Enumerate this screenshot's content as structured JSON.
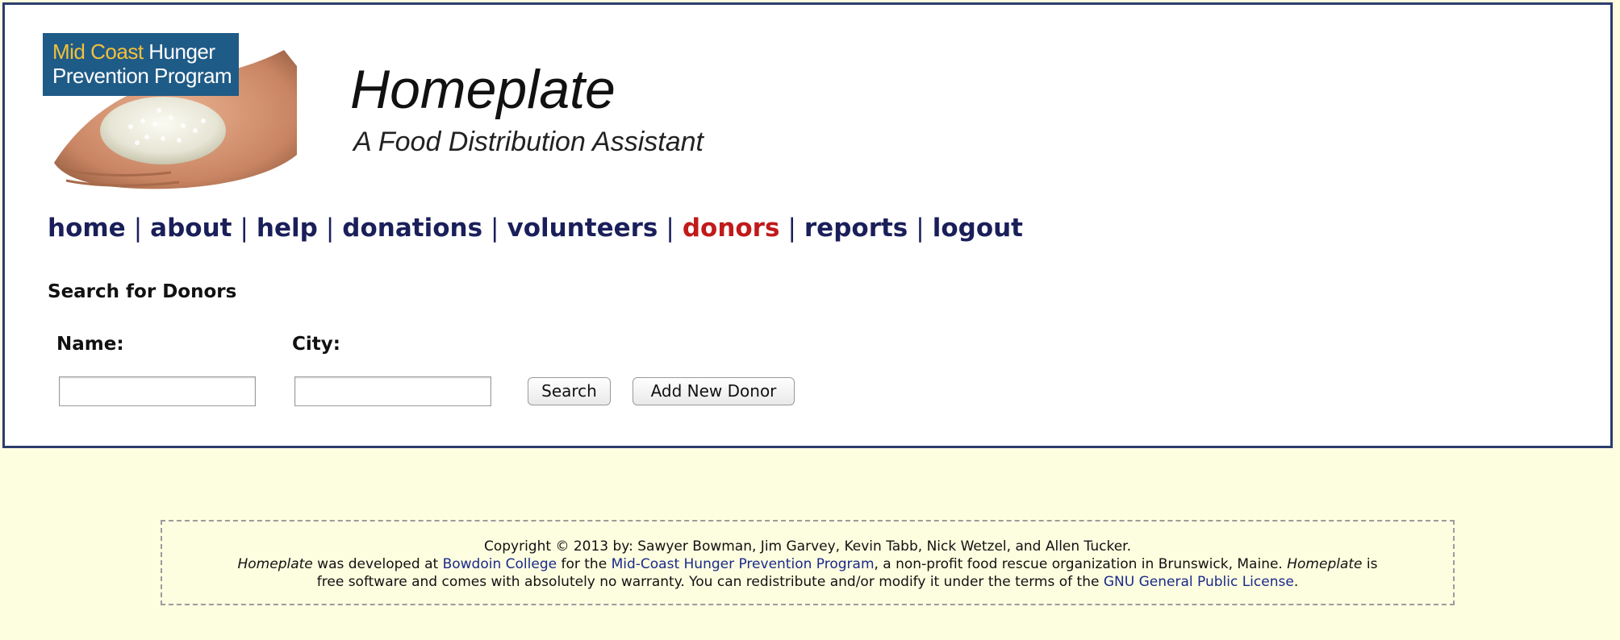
{
  "header": {
    "logo": {
      "line1_highlight": "Mid Coast",
      "line1_rest": " Hunger",
      "line2": "Prevention Program"
    },
    "title": "Homeplate",
    "subtitle": "A Food Distribution Assistant"
  },
  "nav": {
    "items": [
      {
        "label": "home",
        "active": false
      },
      {
        "label": "about",
        "active": false
      },
      {
        "label": "help",
        "active": false
      },
      {
        "label": "donations",
        "active": false
      },
      {
        "label": "volunteers",
        "active": false
      },
      {
        "label": "donors",
        "active": true
      },
      {
        "label": "reports",
        "active": false
      },
      {
        "label": "logout",
        "active": false
      }
    ],
    "separator": "|",
    "active_color": "#c11a1a",
    "link_color": "#1a1f5a"
  },
  "search": {
    "title": "Search for Donors",
    "name_label": "Name:",
    "city_label": "City:",
    "name_value": "",
    "city_value": "",
    "search_button": "Search",
    "add_button": "Add New Donor"
  },
  "footer": {
    "line1": "Copyright © 2013 by: Sawyer Bowman, Jim Garvey, Kevin Tabb, Nick Wetzel, and Allen Tucker.",
    "app_name": "Homeplate",
    "text_developed": " was developed at ",
    "link_college": "Bowdoin College",
    "text_for": " for the ",
    "link_org": "Mid-Coast Hunger Prevention Program",
    "text_org_desc": ", a non-profit food rescue organization in Brunswick, Maine. ",
    "app_name2": "Homeplate",
    "text_is": " is",
    "text_free": "free software and comes with absolutely no warranty. You can redistribute and/or modify it under the terms of the ",
    "link_license": "GNU General Public License",
    "text_end": "."
  },
  "colors": {
    "page_background": "#fdfde0",
    "frame_border": "#2b3c6e",
    "logo_background": "#1f5b87",
    "logo_highlight": "#f2c03a"
  }
}
